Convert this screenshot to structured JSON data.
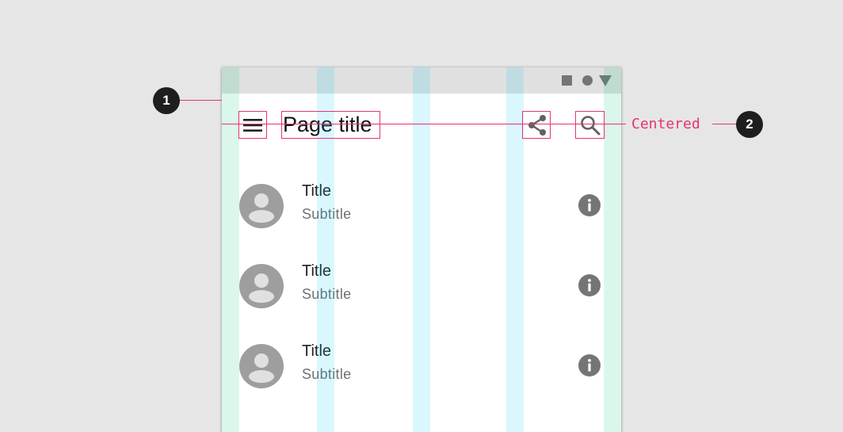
{
  "app_bar": {
    "title": "Page title",
    "leading_icon": "menu-icon",
    "actions": [
      "share-icon",
      "search-icon"
    ]
  },
  "status_bar": {
    "icons": [
      "square-icon",
      "circle-icon",
      "triangle-icon"
    ]
  },
  "list": {
    "items": [
      {
        "title": "Title",
        "subtitle": "Subtitle",
        "avatar": "person-icon",
        "action": "info-icon"
      },
      {
        "title": "Title",
        "subtitle": "Subtitle",
        "avatar": "person-icon",
        "action": "info-icon"
      },
      {
        "title": "Title",
        "subtitle": "Subtitle",
        "avatar": "person-icon",
        "action": "info-icon"
      }
    ]
  },
  "annotations": {
    "callout_1": "1",
    "callout_2": "2",
    "note_2": "Centered",
    "color": "#e8336d"
  },
  "colors": {
    "background": "#e6e6e6",
    "status_bar": "#e0e0e0",
    "icon_grey": "#757575",
    "margin_overlay": "#00c86e",
    "gutter_overlay": "#00c8f5"
  }
}
